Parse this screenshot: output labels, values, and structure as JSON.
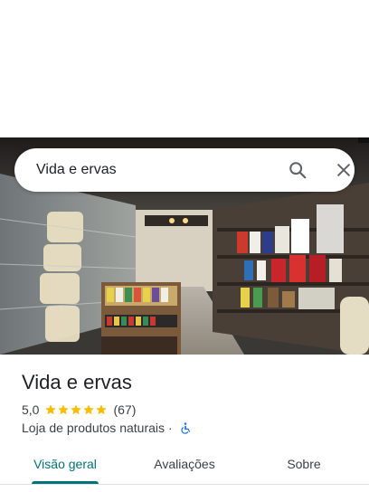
{
  "search": {
    "query": "Vida e ervas",
    "search_icon": "search-icon",
    "close_icon": "close-icon"
  },
  "photo": {
    "description_icon": "store-interior-photo"
  },
  "place": {
    "name": "Vida e ervas",
    "rating": "5,0",
    "stars": 5,
    "reviews": "(67)",
    "category": "Loja de produtos naturais",
    "separator": "·",
    "accessibility_icon": "wheelchair-icon"
  },
  "tabs": [
    {
      "label": "Visão geral",
      "active": true
    },
    {
      "label": "Avaliações",
      "active": false
    },
    {
      "label": "Sobre",
      "active": false
    }
  ],
  "colors": {
    "accent": "#00737a",
    "star": "#fbbc04",
    "text": "#202124",
    "secondary_text": "#3c4043",
    "wheelchair": "#1a73e8"
  }
}
